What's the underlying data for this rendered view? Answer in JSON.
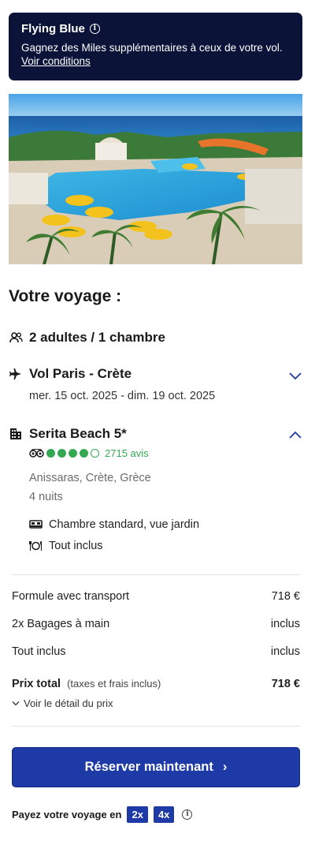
{
  "banner": {
    "title": "Flying Blue",
    "info_glyph": "i",
    "text": "Gagnez des Miles supplémentaires à ceux de votre vol.",
    "link": "Voir conditions"
  },
  "hero": {
    "alt": "hotel-pool-photo"
  },
  "trip": {
    "title": "Votre voyage :",
    "travellers": "2 adultes / 1 chambre",
    "flight": {
      "title": "Vol Paris - Crète",
      "dates": "mer. 15 oct. 2025 - dim. 19 oct. 2025"
    },
    "hotel": {
      "name": "Serita Beach 5*",
      "rating_value": 4,
      "rating_max": 5,
      "reviews": "2715 avis",
      "location": "Anissaras, Crète, Grèce",
      "nights": "4 nuits",
      "room": "Chambre standard, vue jardin",
      "board": "Tout inclus"
    }
  },
  "pricing": {
    "rows": [
      {
        "label": "Formule avec transport",
        "value": "718 €"
      },
      {
        "label": "2x Bagages à main",
        "value": "inclus"
      },
      {
        "label": "Tout inclus",
        "value": "inclus"
      }
    ],
    "total_label": "Prix total",
    "total_note": "(taxes et frais inclus)",
    "total_value": "718 €",
    "detail_link": "Voir le détail du prix"
  },
  "cta": {
    "label": "Réserver maintenant",
    "arrow": "›"
  },
  "payment": {
    "label": "Payez votre voyage en",
    "options": [
      "2x",
      "4x"
    ],
    "info_glyph": "i"
  },
  "colors": {
    "banner_bg": "#0b1438",
    "primary": "#1d3aa6",
    "rating": "#34a853"
  }
}
